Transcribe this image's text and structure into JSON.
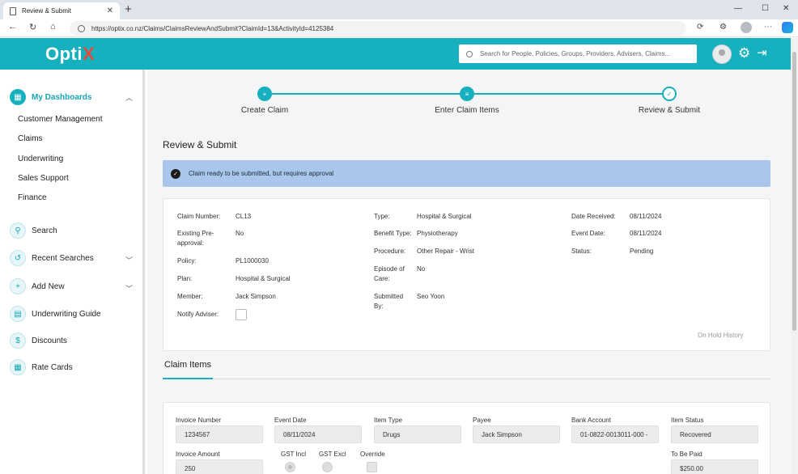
{
  "browser": {
    "tab_title": "Review & Submit",
    "url": "https://optix.co.nz/Claims/ClaimsReviewAndSubmit?ClaimId=13&ActivityId=4125384"
  },
  "header": {
    "logo_main": "Opti",
    "logo_x": "X",
    "search_placeholder": "Search for People, Policies, Groups, Providers, Advisers, Claims..."
  },
  "sidebar": {
    "head": "My Dashboards",
    "sub": [
      "Customer Management",
      "Claims",
      "Underwriting",
      "Sales Support",
      "Finance"
    ],
    "items": [
      "Search",
      "Recent Searches",
      "Add New",
      "Underwriting Guide",
      "Discounts",
      "Rate Cards"
    ]
  },
  "stepper": {
    "steps": [
      "Create Claim",
      "Enter Claim Items",
      "Review & Submit"
    ]
  },
  "page": {
    "title": "Review & Submit",
    "alert": "Claim ready to be submitted, but requires approval",
    "on_hold": "On Hold History",
    "items_tab": "Claim Items"
  },
  "claim": {
    "col1": [
      {
        "label": "Claim Number:",
        "value": "CL13"
      },
      {
        "label": "Existing Pre-approval:",
        "value": "No"
      },
      {
        "label": "Policy:",
        "value": "PL1000030"
      },
      {
        "label": "Plan:",
        "value": "Hospital & Surgical"
      },
      {
        "label": "Member:",
        "value": "Jack Simpson"
      },
      {
        "label": "Notify Adviser:",
        "value": ""
      }
    ],
    "col2": [
      {
        "label": "Type:",
        "value": "Hospital & Surgical"
      },
      {
        "label": "Benefit Type:",
        "value": "Physiotherapy"
      },
      {
        "label": "Procedure:",
        "value": "Other Repair - Wrist"
      },
      {
        "label": "Episode of Care:",
        "value": "No"
      },
      {
        "label": "Submitted By:",
        "value": "Seo Yoon"
      }
    ],
    "col3": [
      {
        "label": "Date Received:",
        "value": "08/11/2024"
      },
      {
        "label": "Event Date:",
        "value": "08/11/2024"
      },
      {
        "label": "Status:",
        "value": "Pending"
      }
    ]
  },
  "item": {
    "invoice_number": {
      "label": "Invoice Number",
      "value": "1234567"
    },
    "event_date": {
      "label": "Event Date",
      "value": "08/11/2024"
    },
    "item_type": {
      "label": "Item Type",
      "value": "Drugs"
    },
    "payee": {
      "label": "Payee",
      "value": "Jack Simpson"
    },
    "bank_account": {
      "label": "Bank Account",
      "value": "01-0822-0013011-000 -"
    },
    "item_status": {
      "label": "Item Status",
      "value": "Recovered"
    },
    "invoice_amount": {
      "label": "Invoice Amount",
      "value": "250"
    },
    "gst_incl": "GST Incl",
    "gst_excl": "GST Excl",
    "override": "Override",
    "to_be_paid": {
      "label": "To Be Paid",
      "value": "$250.00"
    }
  }
}
